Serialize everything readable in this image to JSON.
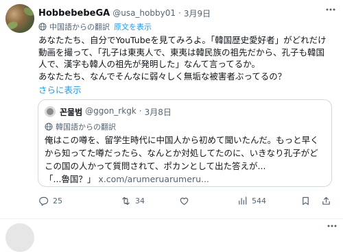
{
  "tweet": {
    "author_name": "HobbebebeGA",
    "author_handle": "@usa_hobby01",
    "separator": "·",
    "date": "3月9日",
    "translated_label": "中国語からの翻訳",
    "original_link": "原文を表示",
    "lines": [
      "あなたたち、自分でYouTubeを見てみろよ。「韓国歴史愛好者」がどれだけ",
      "動画を撮って、「孔子は東夷人で、東夷は韓民族の祖先だから、孔子も韓国",
      "人で、漢字も韓人の祖先が発明した」なんて言ってるか。",
      "あなたたち、なんでそんなに弱々しく無垢な被害者ぶってるの？"
    ],
    "show_more": "さらに表示",
    "quote": {
      "author_name": "꼰물범",
      "author_handle": "@ggon_rkgk",
      "separator": "·",
      "date": "3月8日",
      "translated_label": "韓国語からの翻訳",
      "lines": [
        "俺はこの噂を、留学生時代に中国人から初めて聞いたんだ。もっと早く",
        "から知ってた噂だったら、なんとか対処してたのに、いきなり孔子がど",
        "この国の人かって質問されて、ポカンとして出た答えが..."
      ],
      "last_line_text": "「...魯国？」",
      "link_text": "x.com/arumeruarumeru..."
    },
    "actions": {
      "replies": "25",
      "retweets": "34",
      "likes": "",
      "views": "544"
    }
  },
  "icons": {
    "more": "more-dots-icon",
    "globe": "globe-icon",
    "reply": "reply-icon",
    "retweet": "retweet-icon",
    "like": "heart-icon",
    "views": "bar-chart-icon",
    "bookmark": "bookmark-icon",
    "share": "share-icon"
  },
  "colors": {
    "text": "#0f1419",
    "secondary": "#536471",
    "link": "#1d9bf0",
    "border": "#cfd9de"
  }
}
